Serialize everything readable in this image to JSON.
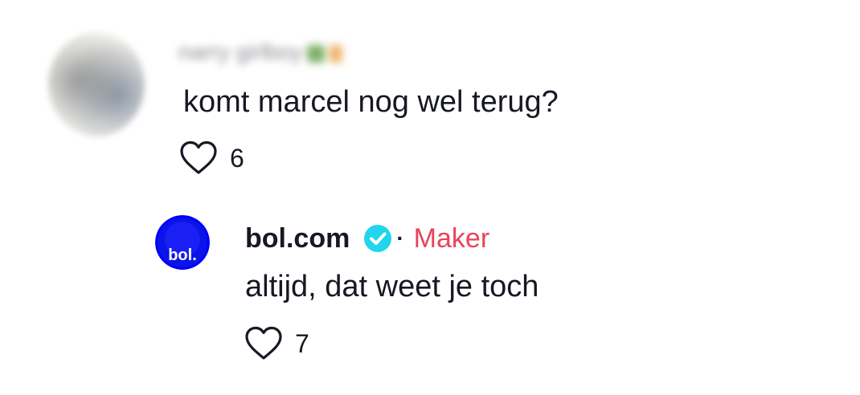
{
  "comment": {
    "username": "narry girlboy",
    "text": "komt marcel nog wel terug?",
    "likes": "6",
    "avatar_icon": "user-avatar-blurred"
  },
  "reply": {
    "username": "bol.com",
    "verified_icon": "verified-badge-icon",
    "separator": "·",
    "badge_label": "Maker",
    "text": "altijd, dat weet je toch",
    "likes": "7",
    "avatar_logo_text": "bol."
  },
  "icons": {
    "like": "heart-outline-icon"
  },
  "colors": {
    "text_primary": "#161823",
    "creator_badge": "#e8445a",
    "verified": "#20d5ec",
    "bol_brand": "#0000ff",
    "icon_stroke": "#161823"
  }
}
